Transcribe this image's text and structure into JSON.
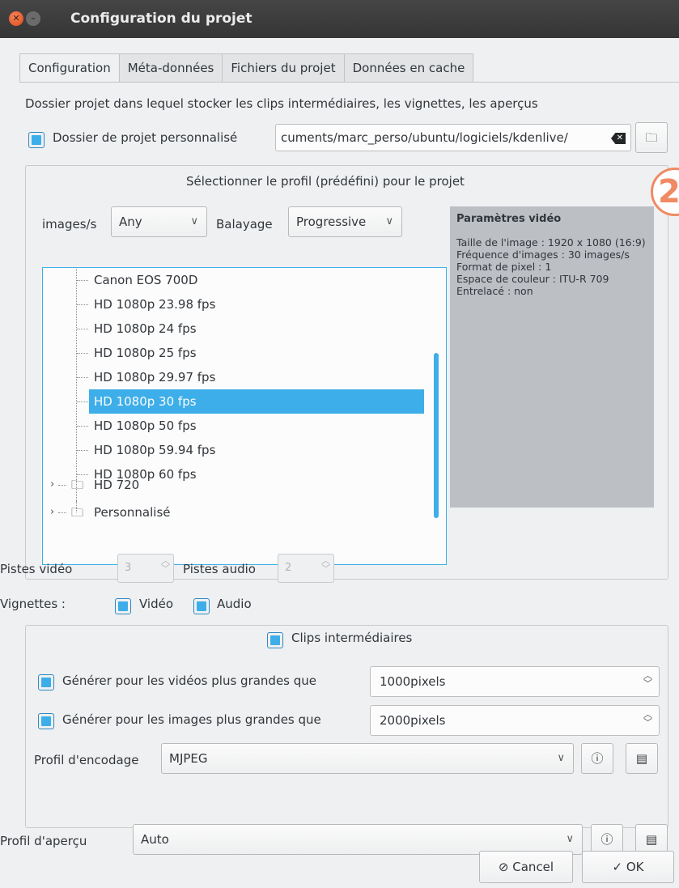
{
  "window": {
    "title": "Configuration du projet"
  },
  "tabs": [
    {
      "label": "Configuration",
      "active": true
    },
    {
      "label": "Méta-données",
      "active": false
    },
    {
      "label": "Fichiers du projet",
      "active": false
    },
    {
      "label": "Données en cache",
      "active": false
    }
  ],
  "project_folder": {
    "description": "Dossier projet dans lequel stocker les clips intermédiaires, les vignettes, les aperçus",
    "custom_label": "Dossier de projet personnalisé",
    "custom_checked": true,
    "path_value": "cuments/marc_perso/ubuntu/logiciels/kdenlive/"
  },
  "profile": {
    "header": "Sélectionner le profil (prédéfini) pour le projet",
    "fps_label": "images/s",
    "fps_value": "Any",
    "scan_label": "Balayage",
    "scan_value": "Progressive",
    "tree_items": [
      {
        "label": "Canon EOS 700D",
        "selected": false
      },
      {
        "label": "HD 1080p 23.98 fps",
        "selected": false
      },
      {
        "label": "HD 1080p 24 fps",
        "selected": false
      },
      {
        "label": "HD 1080p 25 fps",
        "selected": false
      },
      {
        "label": "HD 1080p 29.97 fps",
        "selected": false
      },
      {
        "label": "HD 1080p 30 fps",
        "selected": true
      },
      {
        "label": "HD 1080p 50 fps",
        "selected": false
      },
      {
        "label": "HD 1080p 59.94 fps",
        "selected": false
      },
      {
        "label": "HD 1080p 60 fps",
        "selected": false
      }
    ],
    "tree_folders": [
      {
        "label": "HD 720"
      },
      {
        "label": "Personnalisé"
      }
    ],
    "params_title": "Paramètres vidéo",
    "params_body": "Taille de l'image : 1920 x 1080 (16:9)\nFréquence d'images : 30 images/s\nFormat de pixel : 1\nEspace de couleur : ITU-R 709\nEntrelacé : non"
  },
  "tracks": {
    "video_label": "Pistes vidéo",
    "video_value": "3",
    "audio_label": "Pistes audio",
    "audio_value": "2"
  },
  "thumbnails": {
    "label": "Vignettes :",
    "video_label": "Vidéo",
    "video_checked": true,
    "audio_label": "Audio",
    "audio_checked": true
  },
  "proxy": {
    "header_label": "Clips intermédiaires",
    "header_checked": true,
    "video_label": "Générer pour les vidéos plus grandes que",
    "video_checked": true,
    "video_value": "1000pixels",
    "image_label": "Générer pour les images plus grandes que",
    "image_checked": true,
    "image_value": "2000pixels",
    "encoding_label": "Profil d'encodage",
    "encoding_value": "MJPEG"
  },
  "preview": {
    "label": "Profil d'aperçu",
    "value": "Auto"
  },
  "buttons": {
    "cancel": "Cancel",
    "ok": "OK"
  },
  "annotation": {
    "badge": "2",
    "color": "#f08a63"
  },
  "colors": {
    "accent": "#3daee9",
    "titlebar": "#3c3c3c",
    "window_bg": "#eff0f1"
  }
}
